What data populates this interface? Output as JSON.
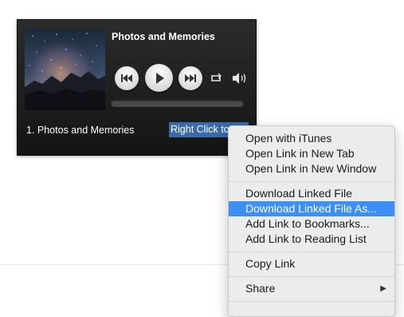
{
  "player": {
    "title": "Photos and Memories",
    "track_label": "1. Photos and Memories",
    "link_text": "Right Click to Download",
    "progress": 0.0,
    "controls": {
      "prev_icon": "previous-track-icon",
      "play_icon": "play-icon",
      "next_icon": "next-track-icon",
      "repeat_icon": "repeat-icon",
      "volume_icon": "volume-icon"
    }
  },
  "context_menu": {
    "items": [
      {
        "label": "Open with iTunes"
      },
      {
        "label": "Open Link in New Tab"
      },
      {
        "label": "Open Link in New Window"
      },
      {
        "label": "Download Linked File"
      },
      {
        "label": "Download Linked File As..."
      },
      {
        "label": "Add Link to Bookmarks..."
      },
      {
        "label": "Add Link to Reading List"
      },
      {
        "label": "Copy Link"
      },
      {
        "label": "Share",
        "submenu_icon": "chevron-right-icon"
      }
    ],
    "highlighted_index": 4
  },
  "colors": {
    "menu_highlight": "#3b8ff5",
    "link_selection": "#3b6aa8",
    "player_background": "#1e1e1e"
  }
}
